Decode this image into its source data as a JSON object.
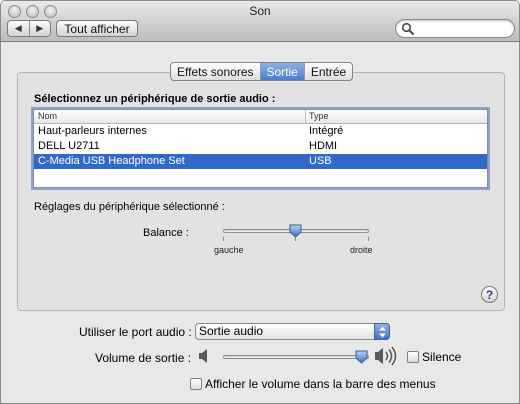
{
  "window": {
    "title": "Son"
  },
  "toolbar": {
    "back_label": "◀",
    "forward_label": "▶",
    "show_all_label": "Tout afficher",
    "search_placeholder": ""
  },
  "tabs": [
    {
      "label": "Effets sonores",
      "active": false
    },
    {
      "label": "Sortie",
      "active": true
    },
    {
      "label": "Entrée",
      "active": false
    }
  ],
  "output": {
    "heading": "Sélectionnez un périphérique de sortie audio :",
    "columns": [
      "Nom",
      "Type"
    ],
    "devices": [
      {
        "name": "Haut-parleurs internes",
        "type": "Intégré",
        "selected": false
      },
      {
        "name": "DELL U2711",
        "type": "HDMI",
        "selected": false
      },
      {
        "name": "C-Media USB Headphone Set",
        "type": "USB",
        "selected": true
      }
    ],
    "settings_heading": "Réglages du périphérique sélectionné :",
    "balance": {
      "label": "Balance :",
      "left_label": "gauche",
      "right_label": "droite",
      "value": 0.5
    }
  },
  "help": {
    "label": "?"
  },
  "bottom": {
    "port_label": "Utiliser le port audio :",
    "port_value": "Sortie audio",
    "volume_label": "Volume de sortie :",
    "volume_value": 0.92,
    "mute_label": "Silence",
    "mute_checked": false,
    "menubar_label": "Afficher le volume dans la barre des menus",
    "menubar_checked": false
  },
  "colors": {
    "selection": "#3169c6",
    "active_tab": "#4b7ccb"
  }
}
